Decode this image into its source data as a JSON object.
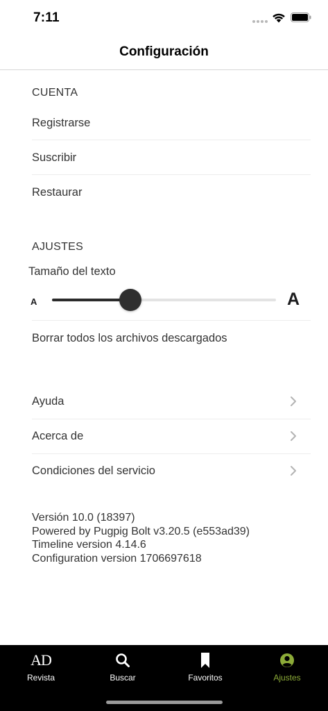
{
  "status": {
    "time": "7:11"
  },
  "nav": {
    "title": "Configuración"
  },
  "account": {
    "header": "CUENTA",
    "items": [
      {
        "label": "Registrarse"
      },
      {
        "label": "Suscribir"
      },
      {
        "label": "Restaurar"
      }
    ]
  },
  "settings": {
    "header": "AJUSTES",
    "text_size_label": "Tamaño del texto",
    "small_a": "A",
    "large_a": "A",
    "text_size_level": 0.35,
    "clear_downloads": "Borrar todos los archivos descargados"
  },
  "links": {
    "items": [
      {
        "label": "Ayuda"
      },
      {
        "label": "Acerca de"
      },
      {
        "label": "Condiciones del servicio"
      }
    ]
  },
  "info": {
    "version": "Versión 10.0 (18397)",
    "powered": "Powered by Pugpig Bolt v3.20.5 (e553ad39)",
    "timeline": "Timeline version 4.14.6",
    "configuration": "Configuration version 1706697618"
  },
  "tabs": [
    {
      "label": "Revista",
      "icon": "ad-logo-icon",
      "logo_text": "AD"
    },
    {
      "label": "Buscar",
      "icon": "search-icon"
    },
    {
      "label": "Favoritos",
      "icon": "bookmark-icon"
    },
    {
      "label": "Ajustes",
      "icon": "profile-icon",
      "active": true
    }
  ],
  "colors": {
    "accent": "#8cab38",
    "tab_bar_bg": "#000000",
    "slider_fill": "#2b2b2b"
  }
}
